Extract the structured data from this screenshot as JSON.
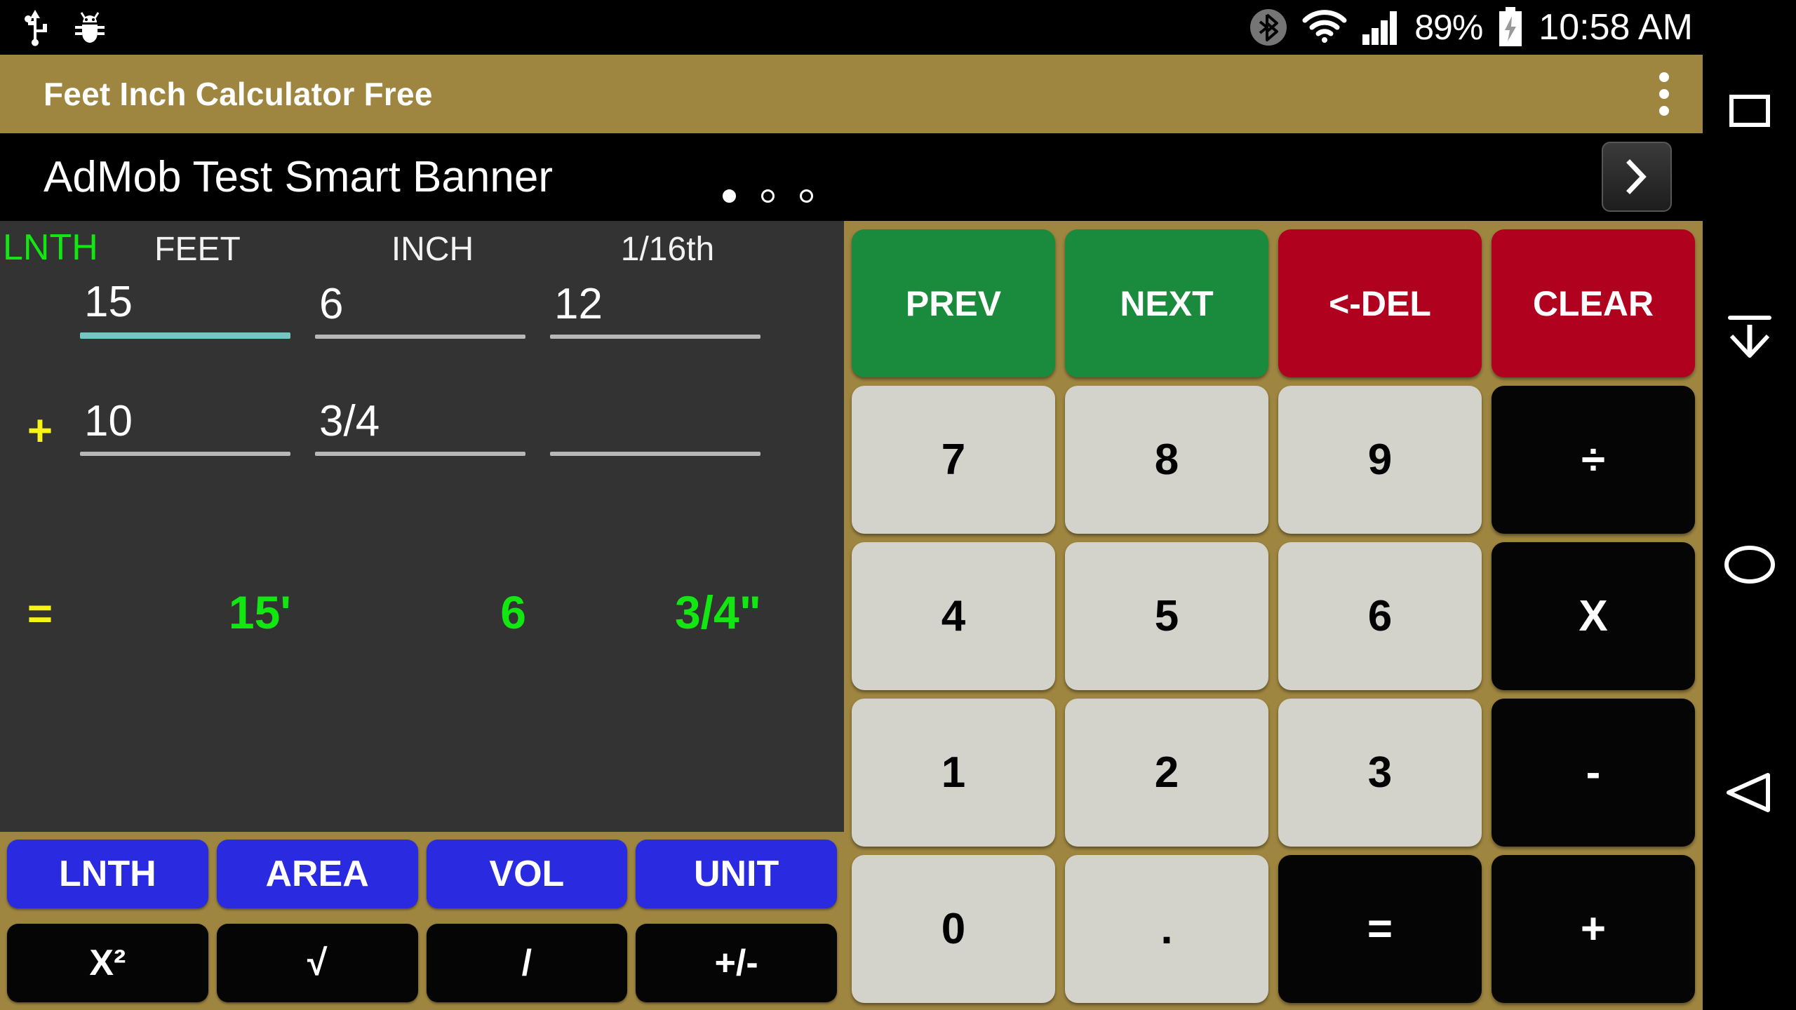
{
  "status_bar": {
    "left_icons": [
      {
        "name": "usb-icon",
        "label": "USB"
      },
      {
        "name": "android-debug-icon",
        "label": "Debug"
      }
    ],
    "bluetooth_icon": "bluetooth-icon",
    "wifi_icon": "wifi-icon",
    "signal_icon": "cellular-signal-icon",
    "battery_percent": "89%",
    "battery_icon": "battery-charging-icon",
    "time": "10:58 AM"
  },
  "title_bar": {
    "title": "Feet Inch Calculator Free",
    "overflow_menu": "overflow-menu-icon",
    "background": "#9e8540"
  },
  "ad_banner": {
    "text": "AdMob Test Smart Banner",
    "dots": [
      true,
      false,
      false
    ],
    "next_button_icon": "chevron-right-icon"
  },
  "display": {
    "mode_label": "LNTH",
    "mode_color": "#12e712",
    "headers": [
      "FEET",
      "INCH",
      "1/16th"
    ],
    "rows": [
      {
        "operator": "",
        "values": [
          "15",
          "6",
          "12"
        ],
        "focused_index": 0
      },
      {
        "operator": "+",
        "values": [
          "10",
          "3/4",
          ""
        ],
        "focused_index": -1
      }
    ],
    "result": {
      "operator": "=",
      "values": [
        "15'",
        "6",
        "3/4\""
      ],
      "color": "#12e712"
    },
    "operator_color": "#f6f318",
    "focus_rule_color": "#73c8c4",
    "rule_color": "#b8b8b8"
  },
  "mode_buttons": [
    {
      "label": "LNTH",
      "name": "mode-button-lnth"
    },
    {
      "label": "AREA",
      "name": "mode-button-area"
    },
    {
      "label": "VOL",
      "name": "mode-button-vol"
    },
    {
      "label": "UNIT",
      "name": "mode-button-unit"
    }
  ],
  "function_buttons": [
    {
      "label": "X²",
      "name": "function-button-square"
    },
    {
      "label": "√",
      "name": "function-button-sqrt"
    },
    {
      "label": "/",
      "name": "function-button-divide"
    },
    {
      "label": "+/-",
      "name": "function-button-sign"
    }
  ],
  "keypad": {
    "rows": [
      [
        {
          "label": "PREV",
          "style": "green",
          "name": "key-prev"
        },
        {
          "label": "NEXT",
          "style": "green",
          "name": "key-next"
        },
        {
          "label": "<-DEL",
          "style": "red",
          "name": "key-delete"
        },
        {
          "label": "CLEAR",
          "style": "red",
          "name": "key-clear"
        }
      ],
      [
        {
          "label": "7",
          "style": "num",
          "name": "key-7"
        },
        {
          "label": "8",
          "style": "num",
          "name": "key-8"
        },
        {
          "label": "9",
          "style": "num",
          "name": "key-9"
        },
        {
          "label": "÷",
          "style": "op",
          "name": "key-divide"
        }
      ],
      [
        {
          "label": "4",
          "style": "num",
          "name": "key-4"
        },
        {
          "label": "5",
          "style": "num",
          "name": "key-5"
        },
        {
          "label": "6",
          "style": "num",
          "name": "key-6"
        },
        {
          "label": "X",
          "style": "op",
          "name": "key-multiply"
        }
      ],
      [
        {
          "label": "1",
          "style": "num",
          "name": "key-1"
        },
        {
          "label": "2",
          "style": "num",
          "name": "key-2"
        },
        {
          "label": "3",
          "style": "num",
          "name": "key-3"
        },
        {
          "label": "-",
          "style": "op",
          "name": "key-minus"
        }
      ],
      [
        {
          "label": "0",
          "style": "num",
          "name": "key-0"
        },
        {
          "label": ".",
          "style": "num",
          "name": "key-decimal"
        },
        {
          "label": "=",
          "style": "op",
          "name": "key-equals"
        },
        {
          "label": "+",
          "style": "op",
          "name": "key-plus"
        }
      ]
    ],
    "colors": {
      "background": "#9e8540",
      "green": "#1a8a3c",
      "red": "#b0021f",
      "number": "#d3d3cc",
      "operator": "#050505"
    }
  },
  "navbar": [
    {
      "name": "nav-recents-button",
      "icon": "square-icon"
    },
    {
      "name": "nav-hide-keyboard-button",
      "icon": "arrow-down-icon"
    },
    {
      "name": "nav-home-button",
      "icon": "circle-icon"
    },
    {
      "name": "nav-back-button",
      "icon": "triangle-left-icon"
    }
  ]
}
